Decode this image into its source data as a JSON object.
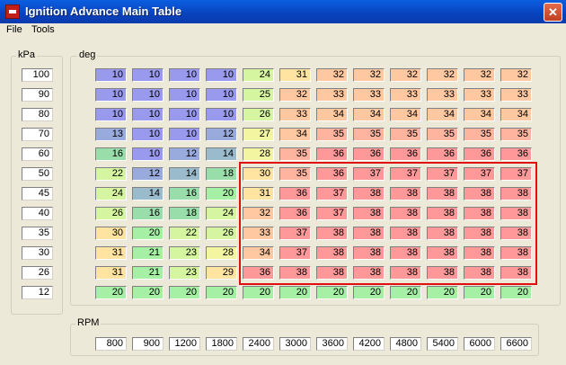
{
  "window": {
    "title": "Ignition Advance Main Table",
    "close_glyph": "✕"
  },
  "menu": [
    "File",
    "Tools"
  ],
  "groups": {
    "kpa": "kPa",
    "deg": "deg",
    "rpm": "RPM"
  },
  "kpa": [
    100,
    90,
    80,
    70,
    60,
    50,
    45,
    40,
    35,
    30,
    26,
    12
  ],
  "rpm": [
    800,
    900,
    1200,
    1800,
    2400,
    3000,
    3600,
    4200,
    4800,
    5400,
    6000,
    6600
  ],
  "table": [
    [
      10,
      10,
      10,
      10,
      24,
      31,
      32,
      32,
      32,
      32,
      32,
      32
    ],
    [
      10,
      10,
      10,
      10,
      25,
      32,
      33,
      33,
      33,
      33,
      33,
      33
    ],
    [
      10,
      10,
      10,
      10,
      26,
      33,
      34,
      34,
      34,
      34,
      34,
      34
    ],
    [
      13,
      10,
      10,
      12,
      27,
      34,
      35,
      35,
      35,
      35,
      35,
      35
    ],
    [
      16,
      10,
      12,
      14,
      28,
      35,
      36,
      36,
      36,
      36,
      36,
      36
    ],
    [
      22,
      12,
      14,
      18,
      30,
      35,
      36,
      37,
      37,
      37,
      37,
      37
    ],
    [
      24,
      14,
      16,
      20,
      31,
      36,
      37,
      38,
      38,
      38,
      38,
      38
    ],
    [
      26,
      16,
      18,
      24,
      32,
      36,
      37,
      38,
      38,
      38,
      38,
      38
    ],
    [
      30,
      20,
      22,
      26,
      33,
      37,
      38,
      38,
      38,
      38,
      38,
      38
    ],
    [
      31,
      21,
      23,
      28,
      34,
      37,
      38,
      38,
      38,
      38,
      38,
      38
    ],
    [
      31,
      21,
      23,
      29,
      36,
      38,
      38,
      38,
      38,
      38,
      38,
      38
    ],
    [
      20,
      20,
      20,
      20,
      20,
      20,
      20,
      20,
      20,
      20,
      20,
      20
    ]
  ],
  "highlight_color": "#E01010"
}
